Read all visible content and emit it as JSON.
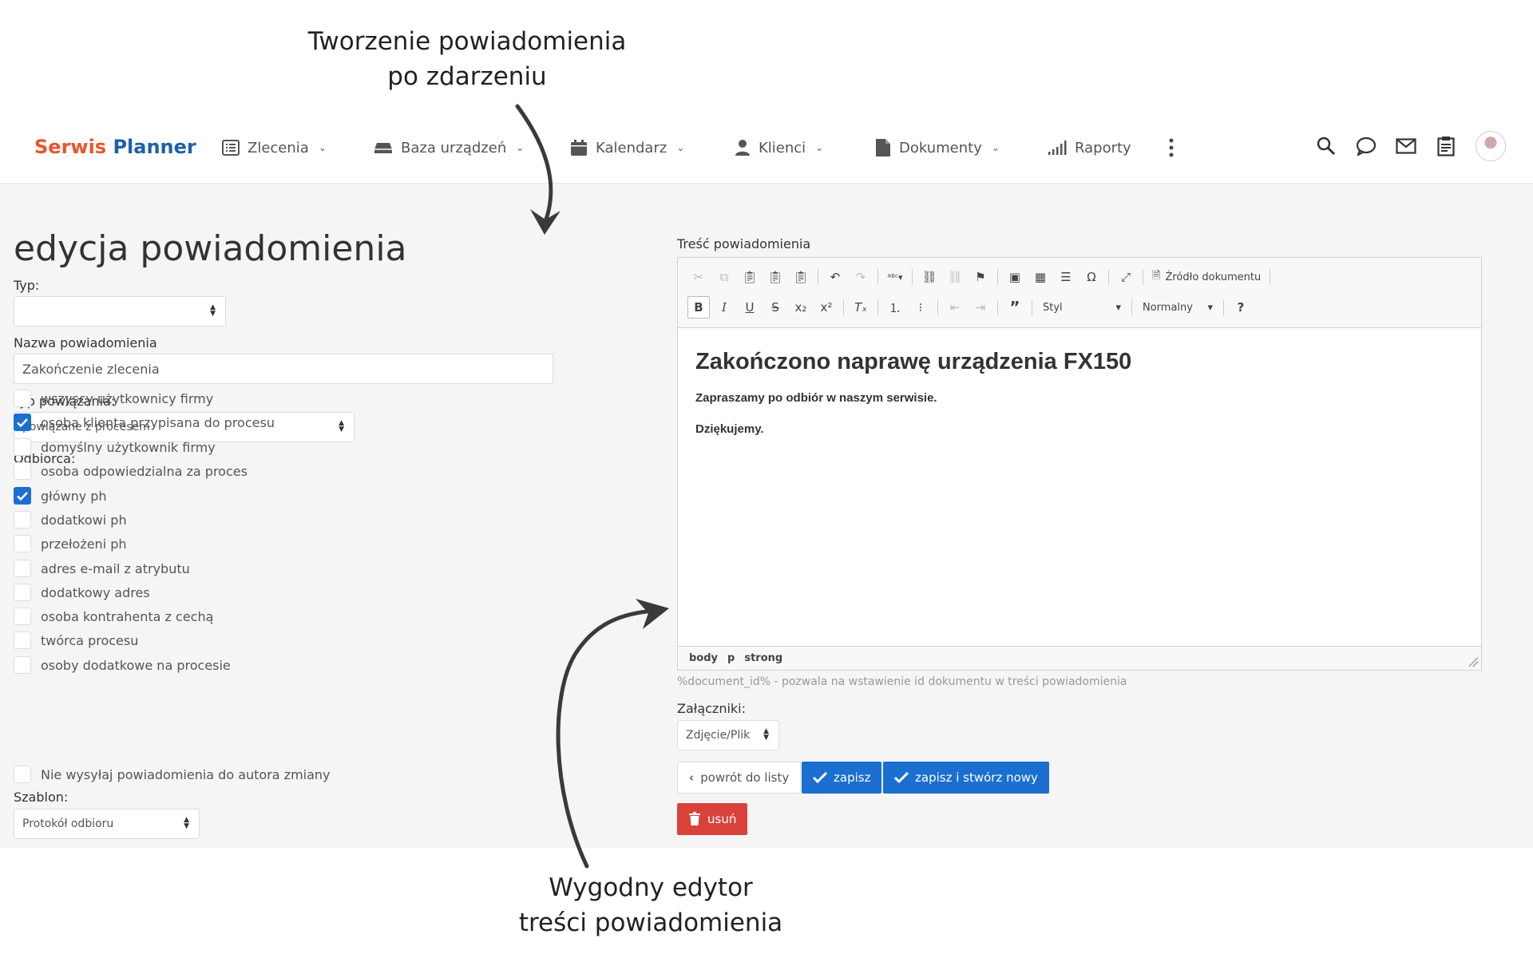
{
  "annotations": {
    "top_line1": "Tworzenie powiadomienia",
    "top_line2": "po zdarzeniu",
    "bottom_line1": "Wygodny edytor",
    "bottom_line2": "treści powiadomienia"
  },
  "nav": {
    "logo_part1": "Serwis",
    "logo_part2": "Planner",
    "items": [
      {
        "label": "Zlecenia",
        "icon": "list-icon"
      },
      {
        "label": "Baza urządzeń",
        "icon": "device-icon"
      },
      {
        "label": "Kalendarz",
        "icon": "calendar-icon"
      },
      {
        "label": "Klienci",
        "icon": "user-icon"
      },
      {
        "label": "Dokumenty",
        "icon": "document-icon"
      },
      {
        "label": "Raporty",
        "icon": "signal-icon"
      }
    ],
    "right_icons": [
      "search-icon",
      "chat-icon",
      "mail-icon",
      "clipboard-icon",
      "avatar"
    ]
  },
  "form": {
    "title": "edycja powiadomienia",
    "typ_label": "Typ:",
    "typ_value": "",
    "nazwa_label": "Nazwa powiadomienia",
    "nazwa_value": "Zakończenie zlecenia",
    "powiazanie_label": "Typ powiązania:",
    "powiazanie_value": "powiązane z procesem",
    "odbiorca_label": "Odbiorca:",
    "recipients": [
      {
        "label": "wszyscy użytkownicy firmy",
        "checked": false
      },
      {
        "label": "osoba klienta przypisana do procesu",
        "checked": true
      },
      {
        "label": "domyślny użytkownik firmy",
        "checked": false
      },
      {
        "label": "osoba odpowiedzialna za proces",
        "checked": false
      },
      {
        "label": "główny ph",
        "checked": true
      },
      {
        "label": "dodatkowi ph",
        "checked": false
      },
      {
        "label": "przełożeni ph",
        "checked": false
      },
      {
        "label": "adres e-mail z atrybutu",
        "checked": false
      },
      {
        "label": "dodatkowy adres",
        "checked": false
      },
      {
        "label": "osoba kontrahenta z cechą",
        "checked": false
      },
      {
        "label": "twórca procesu",
        "checked": false
      },
      {
        "label": "osoby dodatkowe na procesie",
        "checked": false
      }
    ],
    "no_author_label": "Nie wysyłaj powiadomienia do autora zmiany",
    "no_author_checked": false,
    "szablon_label": "Szablon:",
    "szablon_value": "Protokół odbioru"
  },
  "editor": {
    "label": "Treść powiadomienia",
    "source_btn": "Źródło dokumentu",
    "style_combo": "Styl",
    "format_combo": "Normalny",
    "heading": "Zakończono naprawę urządzenia FX150",
    "para1": "Zapraszamy po odbiór w naszym serwisie.",
    "para2": "Dziękujemy.",
    "path": [
      "body",
      "p",
      "strong"
    ],
    "hint": "%document_id% - pozwala na wstawienie id dokumentu w treści powiadomienia"
  },
  "attachments": {
    "label": "Załączniki:",
    "value": "Zdjęcie/Plik"
  },
  "buttons": {
    "back": "powrót do listy",
    "save": "zapisz",
    "save_new": "zapisz i stwórz nowy",
    "delete": "usuń"
  },
  "colors": {
    "logo_orange": "#e8552c",
    "logo_blue": "#1f5fa8",
    "primary": "#1a6fd1",
    "danger": "#d9423a"
  }
}
